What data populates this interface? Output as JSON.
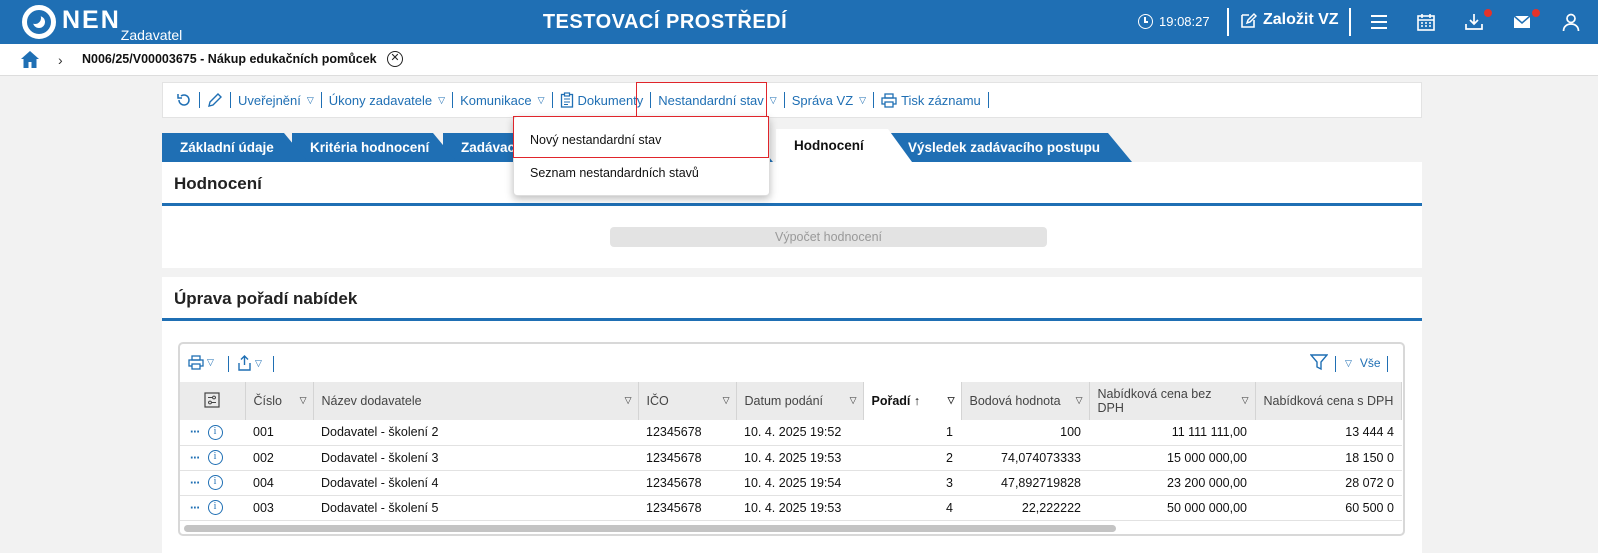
{
  "header": {
    "logo_text": "NEN",
    "logo_sub": "Zadavatel",
    "env_title": "TESTOVACÍ PROSTŘEDÍ",
    "time": "19:08:27",
    "create_label": "Založit VZ"
  },
  "breadcrumb": {
    "title": "N006/25/V00003675 - Nákup edukačních pomůcek"
  },
  "toolbar": {
    "items": [
      {
        "label": "Uveřejnění"
      },
      {
        "label": "Úkony zadavatele"
      },
      {
        "label": "Komunikace"
      },
      {
        "label": "Dokumenty"
      },
      {
        "label": "Nestandardní stav"
      },
      {
        "label": "Správa VZ"
      },
      {
        "label": "Tisk záznamu"
      }
    ]
  },
  "dropdown": {
    "items": [
      {
        "label": "Nový nestandardní stav"
      },
      {
        "label": "Seznam nestandardních stavů"
      }
    ]
  },
  "tabs": [
    {
      "label": "Základní údaje"
    },
    {
      "label": "Kritéria hodnocení"
    },
    {
      "label": "Zadávací"
    },
    {
      "label": "Hodnocení"
    },
    {
      "label": "Výsledek zadávacího postupu"
    }
  ],
  "evaluation": {
    "title": "Hodnocení",
    "calc_button": "Výpočet hodnocení"
  },
  "ranking": {
    "title": "Úprava pořadí nabídek",
    "filter_all": "Vše",
    "columns": [
      "Číslo",
      "Název dodavatele",
      "IČO",
      "Datum podání",
      "Pořadí",
      "Bodová hodnota",
      "Nabídková cena bez DPH",
      "Nabídková cena s DPH"
    ],
    "rows": [
      {
        "cislo": "001",
        "nazev": "Dodavatel - školení 2",
        "ico": "12345678",
        "datum": "10. 4. 2025 19:52",
        "poradi": "1",
        "body": "100",
        "cena_bez": "11 111 111,00",
        "cena_s": "13 444 4"
      },
      {
        "cislo": "002",
        "nazev": "Dodavatel - školení 3",
        "ico": "12345678",
        "datum": "10. 4. 2025 19:53",
        "poradi": "2",
        "body": "74,074073333",
        "cena_bez": "15 000 000,00",
        "cena_s": "18 150 0"
      },
      {
        "cislo": "004",
        "nazev": "Dodavatel - školení 4",
        "ico": "12345678",
        "datum": "10. 4. 2025 19:54",
        "poradi": "3",
        "body": "47,892719828",
        "cena_bez": "23 200 000,00",
        "cena_s": "28 072 0"
      },
      {
        "cislo": "003",
        "nazev": "Dodavatel - školení 5",
        "ico": "12345678",
        "datum": "10. 4. 2025 19:53",
        "poradi": "4",
        "body": "22,222222",
        "cena_bez": "50 000 000,00",
        "cena_s": "60 500 0"
      }
    ]
  }
}
